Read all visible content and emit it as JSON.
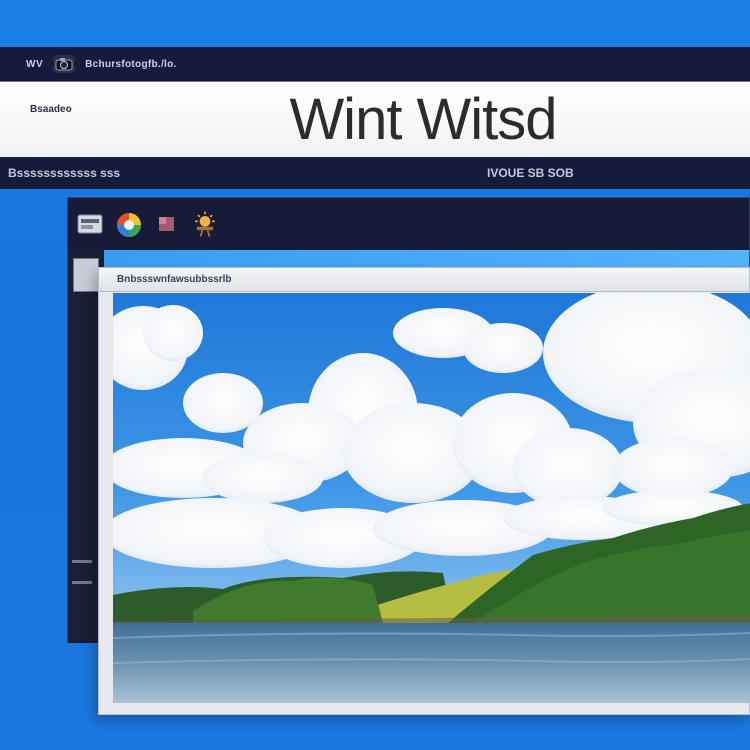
{
  "back_window": {
    "version_label": "WV",
    "app_title": "Bchursfotogfb./lo.",
    "header_left": "Bsaadeo",
    "header_title": "Wint Witsd",
    "status_left": "Bssssssssssss sss",
    "status_right": "IVOUE SB SOB"
  },
  "icons": {
    "camera": "camera-icon",
    "toolbar": [
      "photo-tool-icon",
      "color-wheel-icon",
      "palette-icon",
      "sun-icon"
    ]
  },
  "front_window": {
    "title": "Bnbssswnfawsubbssrlb"
  },
  "colors": {
    "desktop_blue": "#1d7fe6",
    "dark_navy": "#141b3c",
    "sky": "#2e86e0",
    "water": "#5b86a6",
    "hills": "#2f6a27",
    "meadow": "#b9c045"
  }
}
